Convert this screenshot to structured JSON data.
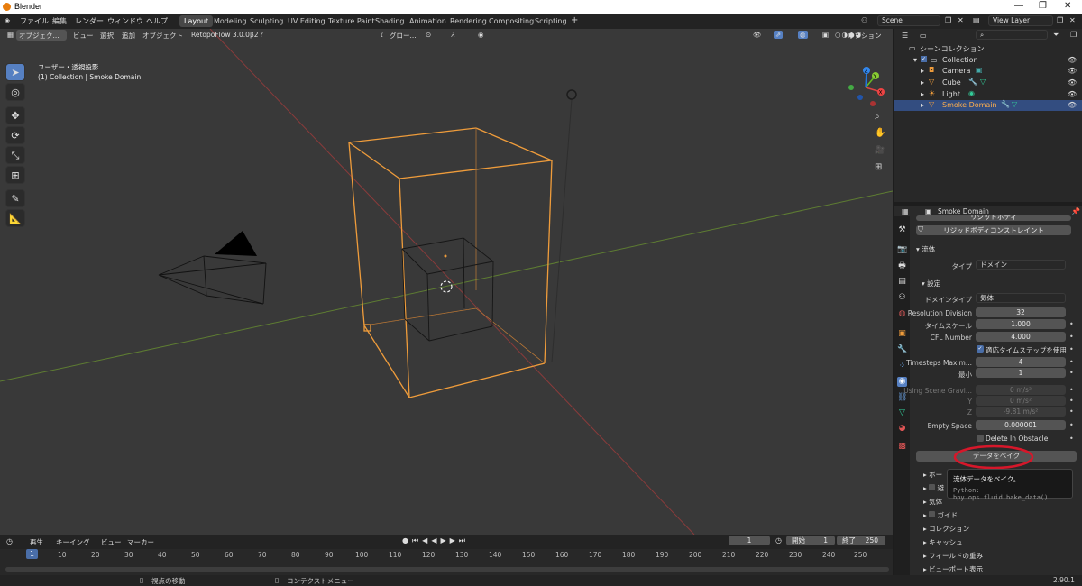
{
  "window": {
    "title": "Blender",
    "controls": [
      "—",
      "❐",
      "✕"
    ]
  },
  "menu": {
    "items": [
      "ファイル",
      "編集",
      "レンダー",
      "ウィンドウ",
      "ヘルプ"
    ]
  },
  "workspaces": [
    "Layout",
    "Modeling",
    "Sculpting",
    "UV Editing",
    "Texture Paint",
    "Shading",
    "Animation",
    "Rendering",
    "Compositing",
    "Scripting"
  ],
  "workspaces_add": "+",
  "scene": {
    "value": "Scene",
    "view_layer": "View Layer"
  },
  "viewport": {
    "header": {
      "mode": "オブジェク...",
      "menus": [
        "ビュー",
        "選択",
        "追加",
        "オブジェクト"
      ],
      "addon": "RetopoFlow 3.0.0β2",
      "transform": "グロー...",
      "overlays": "オプション"
    },
    "info_line1": "ユーザー・透視投影",
    "info_line2": "(1) Collection | Smoke Domain",
    "gizmo": {
      "x": "X",
      "y": "Y",
      "z": "Z"
    }
  },
  "outliner": {
    "root": "シーンコレクション",
    "collection": "Collection",
    "items": [
      {
        "name": "Camera",
        "icon": "camera-icon"
      },
      {
        "name": "Cube",
        "icon": "mesh-icon"
      },
      {
        "name": "Light",
        "icon": "light-icon"
      },
      {
        "name": "Smoke Domain",
        "icon": "mesh-icon",
        "selected": true
      }
    ]
  },
  "properties": {
    "object": "Smoke Domain",
    "partial_button": "リジッドボディ",
    "rigid_constraint": "リジッドボディコンストレイント",
    "fluid_panel": "流体",
    "type_label": "タイプ",
    "type_value": "ドメイン",
    "settings_panel": "設定",
    "domain_type_label": "ドメインタイプ",
    "domain_type_value": "気体",
    "fields": [
      {
        "label": "Resolution Division",
        "value": "32"
      },
      {
        "label": "タイムスケール",
        "value": "1.000"
      },
      {
        "label": "CFL Number",
        "value": "4.000"
      }
    ],
    "adaptive_timesteps": "適応タイムステップを使用",
    "timesteps_max_label": "Timesteps Maxim...",
    "timesteps_max": "4",
    "min_label": "最小",
    "min_value": "1",
    "gravity_label": "Using Scene Gravi...",
    "gravity_x": "0 m/s²",
    "y_label": "Y",
    "gravity_y": "0 m/s²",
    "z_label": "Z",
    "gravity_z": "-9.81 m/s²",
    "empty_space_label": "Empty Space",
    "empty_space": "0.000001",
    "delete_obstacle": "Delete In Obstacle",
    "bake_button": "データをベイク",
    "tooltip_title": "流体データをベイク。",
    "tooltip_python": "Python: bpy.ops.fluid.bake_data()",
    "subpanels": [
      "ボー",
      "避",
      "気体",
      "ガイド",
      "コレクション",
      "キャッシュ",
      "フィールドの重み",
      "ビューポート表示"
    ]
  },
  "timeline": {
    "menus": [
      "再生",
      "キーイング",
      "ビュー",
      "マーカー"
    ],
    "current_frame": "1",
    "start_label": "開始",
    "start": "1",
    "end_label": "終了",
    "end": "250",
    "frames": [
      "1",
      "10",
      "20",
      "30",
      "40",
      "50",
      "60",
      "70",
      "80",
      "90",
      "100",
      "110",
      "120",
      "130",
      "140",
      "150",
      "160",
      "170",
      "180",
      "190",
      "200",
      "210",
      "220",
      "230",
      "240",
      "250"
    ]
  },
  "status": {
    "left": "視点の移動",
    "middle": "コンテクストメニュー",
    "version": "2.90.1"
  },
  "colors": {
    "accent": "#5680c2",
    "selection": "#ef9c3b",
    "highlight_ring": "#d6172a"
  }
}
